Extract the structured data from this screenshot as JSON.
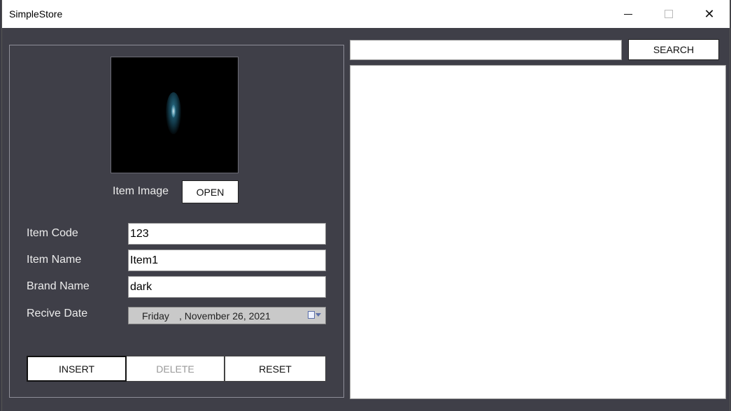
{
  "window": {
    "title": "SimpleStore"
  },
  "item_image": {
    "label": "Item Image",
    "open_label": "OPEN"
  },
  "fields": {
    "item_code": {
      "label": "Item Code",
      "value": "123"
    },
    "item_name": {
      "label": "Item Name",
      "value": "Item1"
    },
    "brand_name": {
      "label": "Brand Name",
      "value": "dark"
    },
    "recive_date": {
      "label": "Recive Date",
      "day": "Friday",
      "date": ", November 26, 2021"
    }
  },
  "actions": {
    "insert": "INSERT",
    "delete": "DELETE",
    "reset": "RESET"
  },
  "search": {
    "value": "",
    "button_label": "SEARCH"
  },
  "icons": {
    "minimize": "minimize-icon",
    "maximize": "maximize-icon",
    "close": "close-icon",
    "calendar": "calendar-dropdown-icon"
  }
}
